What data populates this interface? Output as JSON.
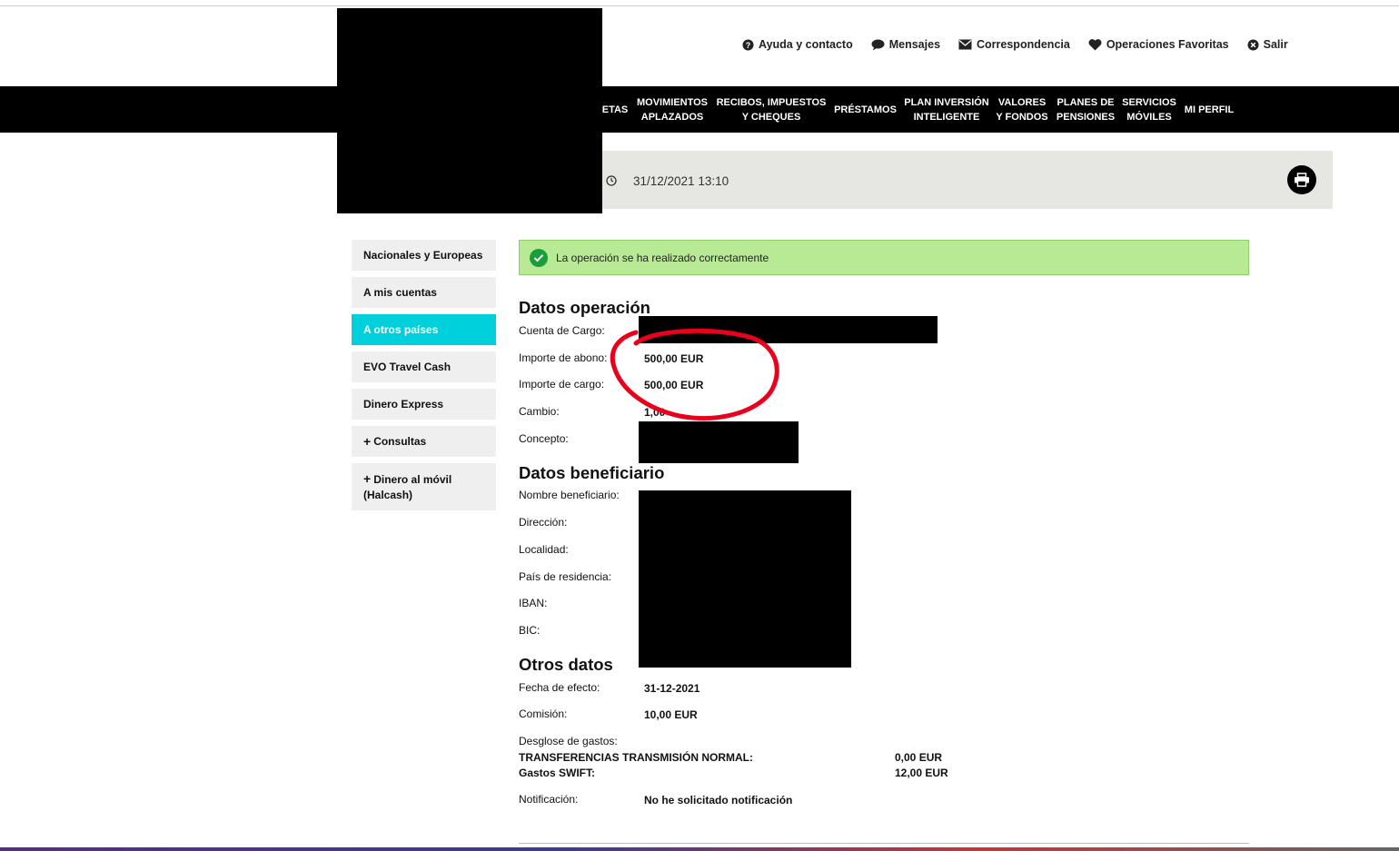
{
  "header": {
    "links": [
      {
        "label": "Ayuda y contacto",
        "icon": "question-circle-icon"
      },
      {
        "label": "Mensajes",
        "icon": "chat-bubble-icon"
      },
      {
        "label": "Correspondencia",
        "icon": "envelope-icon"
      },
      {
        "label": "Operaciones Favoritas",
        "icon": "heart-icon"
      },
      {
        "label": "Salir",
        "icon": "close-circle-icon"
      }
    ]
  },
  "nav": {
    "items": [
      "ETAS",
      "MOVIMIENTOS\nAPLAZADOS",
      "RECIBOS, IMPUESTOS\nY CHEQUES",
      "PRÉSTAMOS",
      "PLAN INVERSIÓN\nINTELIGENTE",
      "VALORES\nY FONDOS",
      "PLANES DE\nPENSIONES",
      "SERVICIOS\nMÓVILES",
      "MI PERFIL"
    ]
  },
  "datebar": {
    "datetime": "31/12/2021 13:10"
  },
  "sidebar": {
    "items": [
      {
        "label": "Nacionales y Europeas",
        "active": false
      },
      {
        "label": "A mis cuentas",
        "active": false
      },
      {
        "label": "A otros países",
        "active": true
      },
      {
        "label": "EVO Travel Cash",
        "active": false
      },
      {
        "label": "Dinero Express",
        "active": false
      },
      {
        "label": "Consultas",
        "active": false,
        "expandable": true
      },
      {
        "label": "Dinero al móvil (Halcash)",
        "active": false,
        "expandable": true
      }
    ]
  },
  "success": {
    "message": "La operación se ha realizado correctamente"
  },
  "operacion": {
    "title": "Datos operación",
    "cuenta_label": "Cuenta de Cargo:",
    "abono_label": "Importe de abono:",
    "abono_value": "500,00 EUR",
    "cargo_label": "Importe de cargo:",
    "cargo_value": "500,00 EUR",
    "cambio_label": "Cambio:",
    "cambio_value": "1,00",
    "concepto_label": "Concepto:"
  },
  "beneficiario": {
    "title": "Datos beneficiario",
    "nombre_label": "Nombre beneficiario:",
    "direccion_label": "Dirección:",
    "localidad_label": "Localidad:",
    "pais_label": "País de residencia:",
    "iban_label": "IBAN:",
    "bic_label": "BIC:"
  },
  "otros": {
    "title": "Otros datos",
    "fecha_label": "Fecha de efecto:",
    "fecha_value": "31-12-2021",
    "comision_label": "Comisión:",
    "comision_value": "10,00 EUR",
    "desglose_label": "Desglose de gastos:",
    "transf_label": "TRANSFERENCIAS TRANSMISIÓN NORMAL:",
    "transf_value": "0,00 EUR",
    "swift_label": "Gastos SWIFT:",
    "swift_value": "12,00 EUR",
    "notif_label": "Notificación:",
    "notif_value": "No he solicitado notificación"
  },
  "colors": {
    "nav_bg": "#000000",
    "active_tab": "#00d0dc",
    "success_bg": "#b8ea96",
    "annotation": "#e8001c"
  }
}
